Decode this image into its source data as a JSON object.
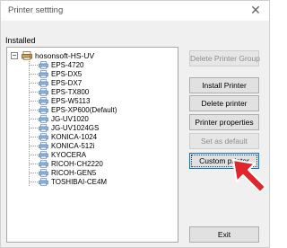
{
  "window": {
    "title": "Printer settting",
    "close_glyph": "✕"
  },
  "tree": {
    "section_label": "Installed",
    "root": {
      "expander": "−",
      "label": "hosonsoft-HS-UV",
      "icon": "printer-group-icon"
    },
    "printers": [
      "EPS-4720",
      "EPS-DX5",
      "EPS-DX7",
      "EPS-TX800",
      "EPS-W5113",
      "EPS-XP600(Default)",
      "JG-UV1020",
      "JG-UV1024GS",
      "KONICA-1024",
      "KONICA-512i",
      "KYOCERA",
      "RICOH-CH2220",
      "RICOH-GEN5",
      "TOSHIBAI-CE4M"
    ]
  },
  "buttons": {
    "delete_group": "Delete Printer Group",
    "install": "Install Printer",
    "delete": "Delete printer",
    "properties": "Printer properties",
    "set_default": "Set as default",
    "custom": "Custom printer",
    "exit": "Exit"
  },
  "annotation": {
    "icon": "red-arrow-icon",
    "color": "#e0262c"
  }
}
